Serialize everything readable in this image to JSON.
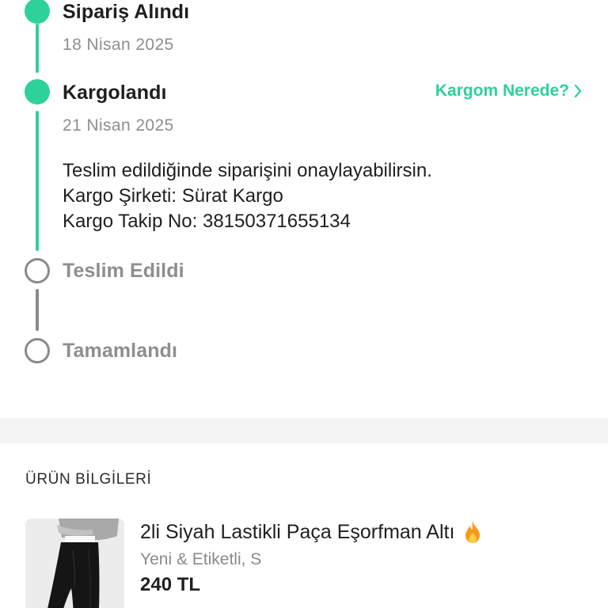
{
  "timeline": {
    "steps": [
      {
        "title": "Sipariş Alındı",
        "date": "18 Nisan 2025",
        "status": "done"
      },
      {
        "title": "Kargolandı",
        "date": "21 Nisan 2025",
        "status": "done",
        "details": [
          "Teslim edildiğinde siparişini onaylayabilirsin.",
          "Kargo Şirketi: Sürat Kargo",
          "Kargo Takip No: 38150371655134"
        ],
        "link_label": "Kargom Nerede?"
      },
      {
        "title": "Teslim Edildi",
        "status": "pending"
      },
      {
        "title": "Tamamlandı",
        "status": "pending"
      }
    ]
  },
  "product_section": {
    "title": "ÜRÜN BİLGİLERİ",
    "product": {
      "name": "2li Siyah Lastikli Paça Eşorfman Altı",
      "badge_icon": "fire-icon",
      "condition": "Yeni & Etiketli, S",
      "price": "240 TL"
    }
  },
  "colors": {
    "accent": "#2ed199",
    "muted": "#8e8e8e",
    "text": "#1f1f1f",
    "separator": "#f4f4f4"
  }
}
